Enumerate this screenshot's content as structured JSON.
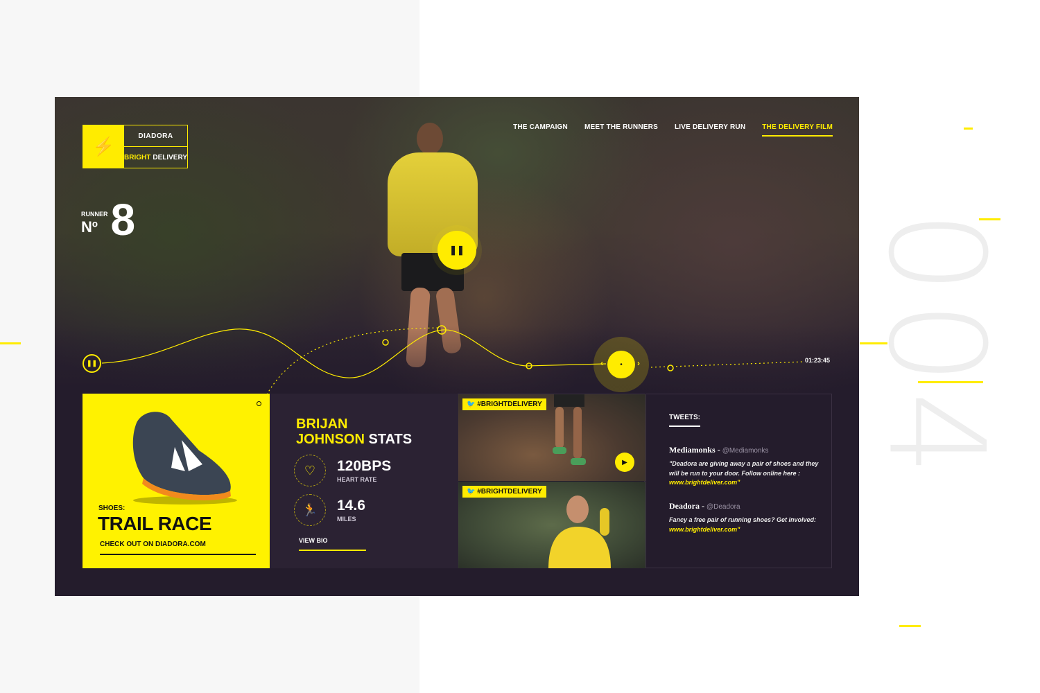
{
  "decor": {
    "big_number": "004"
  },
  "logo": {
    "brand": "DIADORA",
    "tag_highlight": "BRIGHT",
    "tag_rest": "DELIVERY"
  },
  "nav": {
    "items": [
      {
        "label": "THE CAMPAIGN",
        "active": false
      },
      {
        "label": "MEET THE RUNNERS",
        "active": false
      },
      {
        "label": "LIVE DELIVERY RUN",
        "active": false
      },
      {
        "label": "THE DELIVERY FILM",
        "active": true
      }
    ]
  },
  "runner": {
    "label": "RUNNER",
    "no_symbol": "Nº",
    "number": "8"
  },
  "player": {
    "time": "01:23:45"
  },
  "shoe": {
    "label": "SHOES:",
    "name": "TRAIL RACE",
    "link": "CHECK OUT ON DIADORA.COM"
  },
  "stats": {
    "name_line1": "BRIJAN",
    "name_line2": "JOHNSON",
    "title_suffix": "STATS",
    "heart_value": "120BPS",
    "heart_label": "HEART RATE",
    "miles_value": "14.6",
    "miles_label": "MILES",
    "view_bio": "VIEW BIO"
  },
  "media": {
    "hashtag_top": "#BRIGHTDELIVERY",
    "hashtag_bottom": "#BRIGHTDELIVERY"
  },
  "tweets": {
    "title": "TWEETS:",
    "items": [
      {
        "name": "Mediamonks",
        "handle": "@Mediamonks",
        "text": "\"Deadora are giving away a pair of shoes and they will be run to your door. Follow online here :",
        "link": "www.brightdeliver.com\""
      },
      {
        "name": "Deadora",
        "handle": "@Deadora",
        "text": "Fancy a free pair of running shoes? Get involved:",
        "link": "www.brightdeliver.com\""
      }
    ]
  },
  "colors": {
    "accent": "#ffec00",
    "panel": "#241c2c"
  }
}
